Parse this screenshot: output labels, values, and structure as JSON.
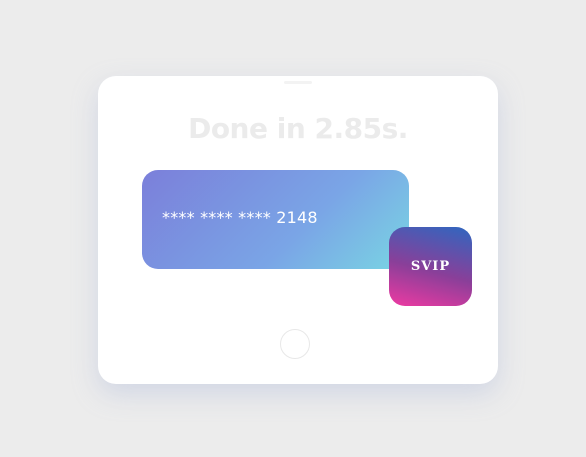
{
  "status": {
    "headline": "Done in 2.85s."
  },
  "card": {
    "number": "**** **** **** 2148"
  },
  "badge": {
    "label": "SVIP"
  },
  "colors": {
    "background": "#ececec",
    "tablet": "#ffffff",
    "card_gradient": [
      "#7b7fda",
      "#7aa5e6",
      "#79d6e3"
    ],
    "badge_gradient": [
      "#2f67c0",
      "#8a3f99",
      "#ee3aa2"
    ],
    "headline_text": "#ebebeb"
  }
}
